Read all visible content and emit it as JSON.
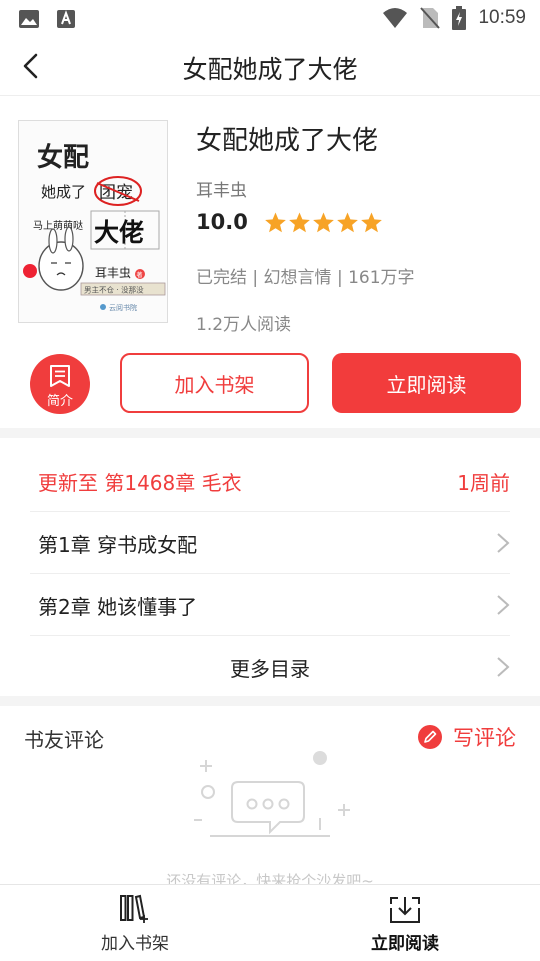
{
  "status_bar": {
    "time": "10:59"
  },
  "nav": {
    "title": "女配她成了大佬"
  },
  "book": {
    "title": "女配她成了大佬",
    "author": "耳丰虫",
    "score": "10.0",
    "rating_stars": 5,
    "meta": "已完结 | 幻想言情 | 161万字",
    "readers": "1.2万人阅读"
  },
  "cover": {
    "line1": "女配",
    "line2": "她成了",
    "stamp": "团宠",
    "line3": "大佬",
    "tag": "马上萌萌哒",
    "author": "耳丰虫",
    "author_badge": "著",
    "slogan": "男主不仓 · 没那没",
    "publisher": "云阅书院"
  },
  "actions": {
    "intro_label": "简介",
    "add_shelf_label": "加入书架",
    "read_now_label": "立即阅读"
  },
  "chapters": {
    "latest_label": "更新至 第1468章 毛衣",
    "latest_time": "1周前",
    "items": [
      "第1章 穿书成女配",
      "第2章 她该懂事了"
    ],
    "more_label": "更多目录"
  },
  "reviews": {
    "title": "书友评论",
    "write_label": "写评论",
    "empty_text": "还没有评论，快来抢个沙发吧~"
  },
  "tabbar": {
    "add_shelf_label": "加入书架",
    "read_now_label": "立即阅读"
  },
  "colors": {
    "accent": "#f03d3d",
    "star": "#f7a326"
  }
}
